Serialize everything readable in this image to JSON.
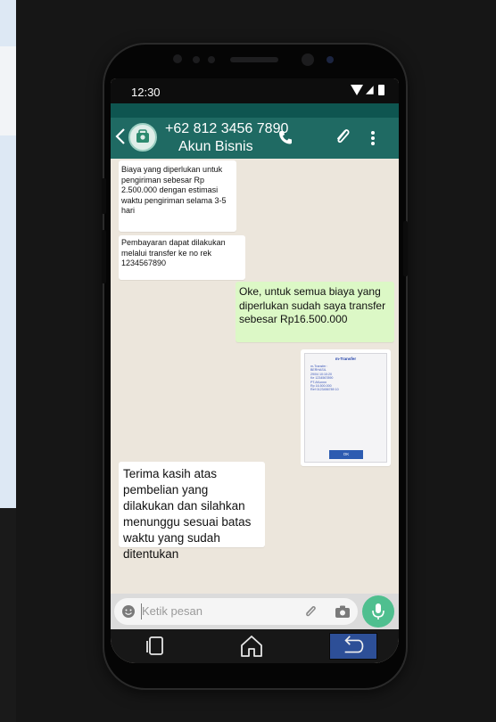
{
  "status_bar": {
    "time": "12:30"
  },
  "header": {
    "contact_number": "+62 812 3456 7890",
    "contact_subtitle": "Akun Bisnis"
  },
  "messages": [
    {
      "direction": "incoming",
      "text": "Biaya yang diperlukan untuk pengiriman sebesar Rp 2.500.000 dengan estimasi waktu pengiriman selama 3-5 hari"
    },
    {
      "direction": "incoming",
      "text": "Pembayaran dapat dilakukan melalui transfer ke no rek 1234567890"
    },
    {
      "direction": "outgoing",
      "text": "Oke, untuk semua biaya yang diperlukan sudah saya transfer sebesar Rp16.500.000"
    },
    {
      "direction": "outgoing",
      "type": "image"
    },
    {
      "direction": "incoming",
      "text": "Terima kasih atas pembelian yang dilakukan dan silahkan menunggu sesuai batas waktu yang sudah ditentukan"
    }
  ],
  "input": {
    "placeholder": "Ketik pesan"
  },
  "colors": {
    "header": "#1f6a63",
    "chat_background": "#ece6dc",
    "outgoing_bubble": "#dcf8c6",
    "mic_button": "#4fbf8f"
  },
  "icons": [
    "back-arrow-icon",
    "avatar-icon",
    "call-icon",
    "attach-icon",
    "menu-icon",
    "emoji-icon",
    "camera-icon",
    "mic-icon",
    "recent-apps-icon",
    "home-icon",
    "back-icon",
    "signal-icon",
    "battery-icon"
  ]
}
